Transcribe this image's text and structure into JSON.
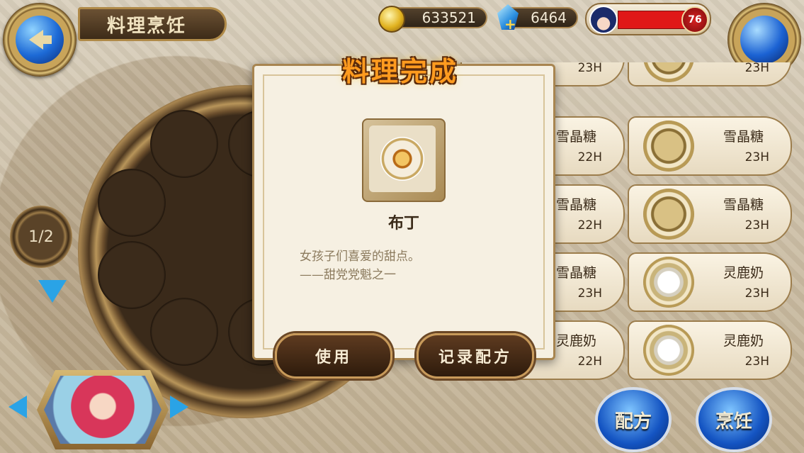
{
  "header": {
    "title": "料理烹饪",
    "gold": "633521",
    "gems": "6464",
    "player_level": "76"
  },
  "wheel": {
    "page_indicator": "1/2"
  },
  "recipe_list": {
    "items": [
      {
        "name": "",
        "time": "23H",
        "pot": "plain"
      },
      {
        "name": "",
        "time": "23H",
        "pot": "plain"
      },
      {
        "name": "雪晶糖",
        "time": "22H",
        "pot": "plain"
      },
      {
        "name": "雪晶糖",
        "time": "23H",
        "pot": "plain"
      },
      {
        "name": "雪晶糖",
        "time": "22H",
        "pot": "plain"
      },
      {
        "name": "雪晶糖",
        "time": "23H",
        "pot": "plain"
      },
      {
        "name": "雪晶糖",
        "time": "23H",
        "pot": "milk"
      },
      {
        "name": "灵鹿奶",
        "time": "23H",
        "pot": "milk"
      },
      {
        "name": "灵鹿奶",
        "time": "22H",
        "pot": "milk"
      },
      {
        "name": "灵鹿奶",
        "time": "23H",
        "pot": "milk"
      }
    ]
  },
  "bottom_buttons": {
    "recipe": "配方",
    "cook": "烹饪"
  },
  "modal": {
    "banner": "料理完成",
    "item_name": "布丁",
    "desc_line1": "女孩子们喜爱的甜点。",
    "desc_line2": "——甜党党魁之一",
    "use_label": "使用",
    "record_label": "记录配方"
  }
}
